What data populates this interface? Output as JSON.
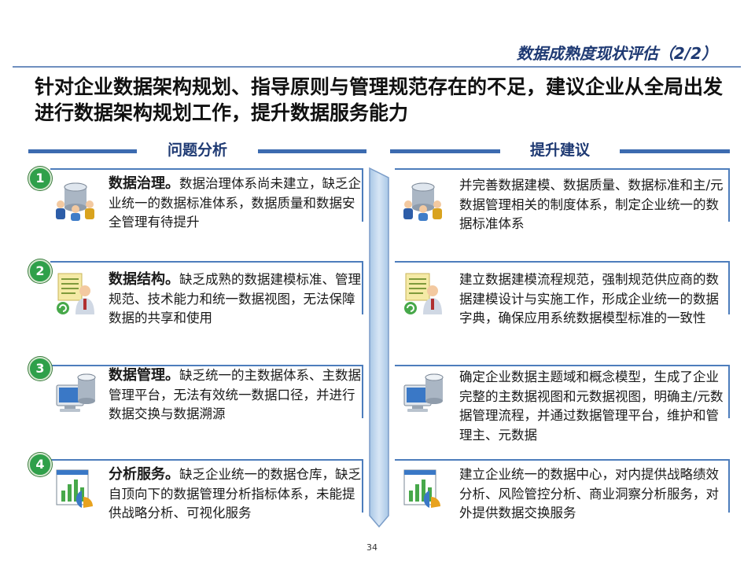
{
  "header": {
    "title": "数据成熟度现状评估（2/2）",
    "headline": "针对企业数据架构规划、指导原则与管理规范存在的不足，建议企业从全局出发进行数据架构规划工作，提升数据服务能力"
  },
  "columns": {
    "left_label": "问题分析",
    "right_label": "提升建议"
  },
  "problems": [
    {
      "num": "1",
      "bold": "数据治理。",
      "text": "数据治理体系尚未建立，缺乏企业统一的数据标准体系，数据质量和数据安全管理有待提升",
      "icon": "database-users-icon"
    },
    {
      "num": "2",
      "bold": "数据结构。",
      "text": "缺乏成熟的数据建模标准、管理规范、技术能力和统一数据视图，无法保障数据的共享和使用",
      "icon": "user-document-icon"
    },
    {
      "num": "3",
      "bold": "数据管理。",
      "text": "缺乏统一的主数据体系、主数据管理平台，无法有效统一数据口径，并进行数据交换与数据溯源",
      "icon": "database-monitor-icon"
    },
    {
      "num": "4",
      "bold": "分析服务。",
      "text": "缺乏企业统一的数据仓库，缺乏自顶向下的数据管理分析指标体系，未能提供战略分析、可视化服务",
      "icon": "analytics-chart-icon"
    }
  ],
  "suggestions": [
    {
      "text": "并完善数据建模、数据质量、数据标准和主/元数据管理相关的制度体系，制定企业统一的数据标准体系",
      "icon": "database-users-icon"
    },
    {
      "text": "建立数据建模流程规范，强制规范供应商的数据建模设计与实施工作，形成企业统一的数据字典，确保应用系统数据模型标准的一致性",
      "icon": "user-document-icon"
    },
    {
      "text": "确定企业数据主题域和概念模型，生成了企业完整的主数据视图和元数据视图，明确主/元数据管理流程，并通过数据管理平台，维护和管理主、元数据",
      "icon": "database-monitor-icon"
    },
    {
      "text": "建立企业统一的数据中心，对内提供战略绩效分析、风险管控分析、商业洞察分析服务，对外提供数据交换服务",
      "icon": "analytics-chart-icon"
    }
  ],
  "footer": {
    "page": "34"
  }
}
